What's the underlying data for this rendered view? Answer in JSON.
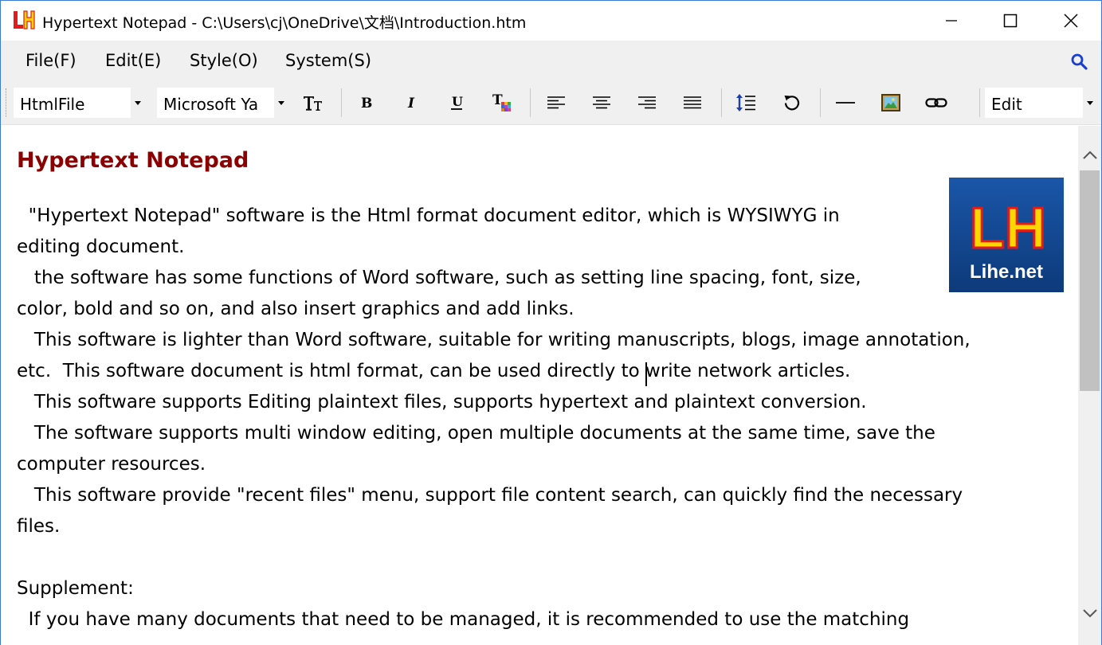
{
  "window": {
    "title": "Hypertext Notepad - C:\\Users\\cj\\OneDrive\\文档\\Introduction.htm",
    "accent_color": "#3a7bd5"
  },
  "menu": {
    "items": [
      "File(F)",
      "Edit(E)",
      "Style(O)",
      "System(S)"
    ],
    "search_icon": "search-icon"
  },
  "toolbar": {
    "file_type": "HtmlFile",
    "font_name": "Microsoft Ya",
    "mode": "Edit",
    "buttons": [
      "font-size-icon",
      "bold-icon",
      "italic-icon",
      "underline-icon",
      "font-color-icon",
      "align-left-icon",
      "align-center-icon",
      "align-right-icon",
      "justify-icon",
      "line-spacing-icon",
      "undo-icon",
      "horizontal-rule-icon",
      "insert-image-icon",
      "insert-link-icon"
    ]
  },
  "document": {
    "heading": "Hypertext Notepad",
    "heading_color": "#8b0000",
    "logo_text": "Lihe.net",
    "logo_letters": "LH",
    "lines": [
      "  \"Hypertext Notepad\" software is the Html format document editor, which is WYSIWYG in",
      "editing document.",
      "   the software has some functions of Word software, such as setting line spacing, font, size,",
      "color, bold and so on, and also insert graphics and add links.",
      "   This software is lighter than Word software, suitable for writing manuscripts, blogs, image annotation,",
      "etc.  This software document is html format, can be used directly to write network articles.",
      "   This software supports Editing plaintext files, supports hypertext and plaintext conversion.",
      "   The software supports multi window editing, open multiple documents at the same time, save the",
      "computer resources.",
      "   This software provide \"recent files\" menu, support file content search, can quickly find the necessary",
      "files.",
      "",
      "Supplement:",
      "  If you have many documents that need to be managed, it is recommended to use the matching"
    ]
  }
}
